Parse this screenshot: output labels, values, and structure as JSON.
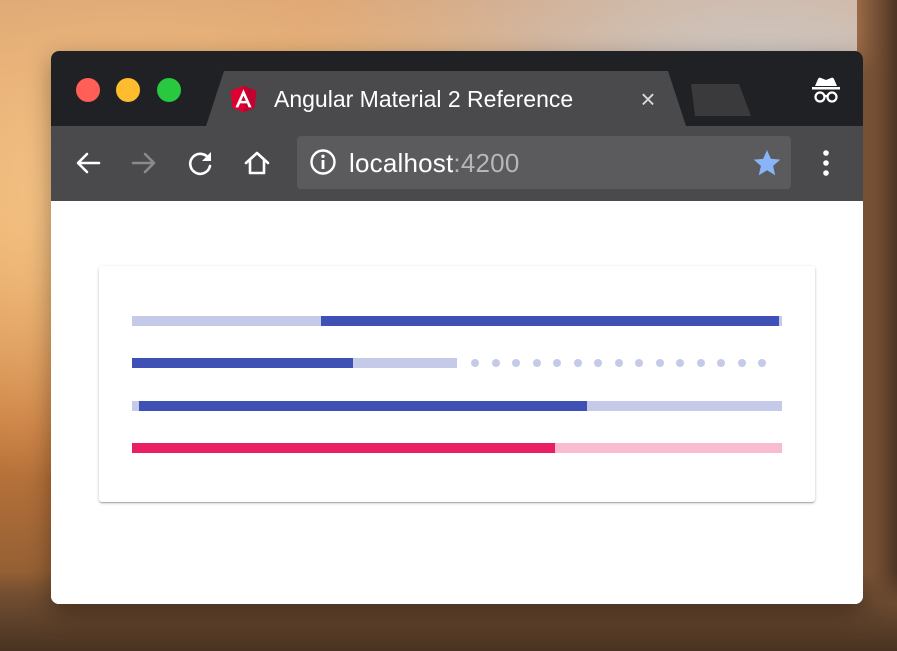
{
  "browser": {
    "tab": {
      "title": "Angular Material 2 Reference",
      "close_glyph": "×",
      "favicon": "angular-icon"
    },
    "address": {
      "host": "localhost",
      "port": ":4200"
    },
    "icons": {
      "back": "arrow-left-icon",
      "forward": "arrow-right-icon",
      "reload": "reload-icon",
      "home": "home-icon",
      "info": "info-icon",
      "bookmark": "star-icon",
      "menu": "more-vert-icon",
      "incognito": "incognito-icon"
    },
    "colors": {
      "titlebar": "#202124",
      "toolbar": "#4a4a4c",
      "omnibox": "#5b5b5e",
      "star": "#8ab4f8"
    }
  },
  "progress_bars": [
    {
      "mode": "query",
      "color": "primary",
      "value_start": 0.29,
      "value_end": 0.995
    },
    {
      "mode": "buffer",
      "color": "primary",
      "value": 0.34,
      "buffer": 0.5
    },
    {
      "mode": "indeterminate",
      "color": "primary",
      "value_start": 0.01,
      "value_end": 0.7
    },
    {
      "mode": "determinate",
      "color": "accent",
      "value": 0.65
    }
  ],
  "palette": {
    "primary": "#3f51b5",
    "primary_light": "#c5cae9",
    "accent": "#e91e63",
    "accent_light": "#f8bbd0"
  }
}
